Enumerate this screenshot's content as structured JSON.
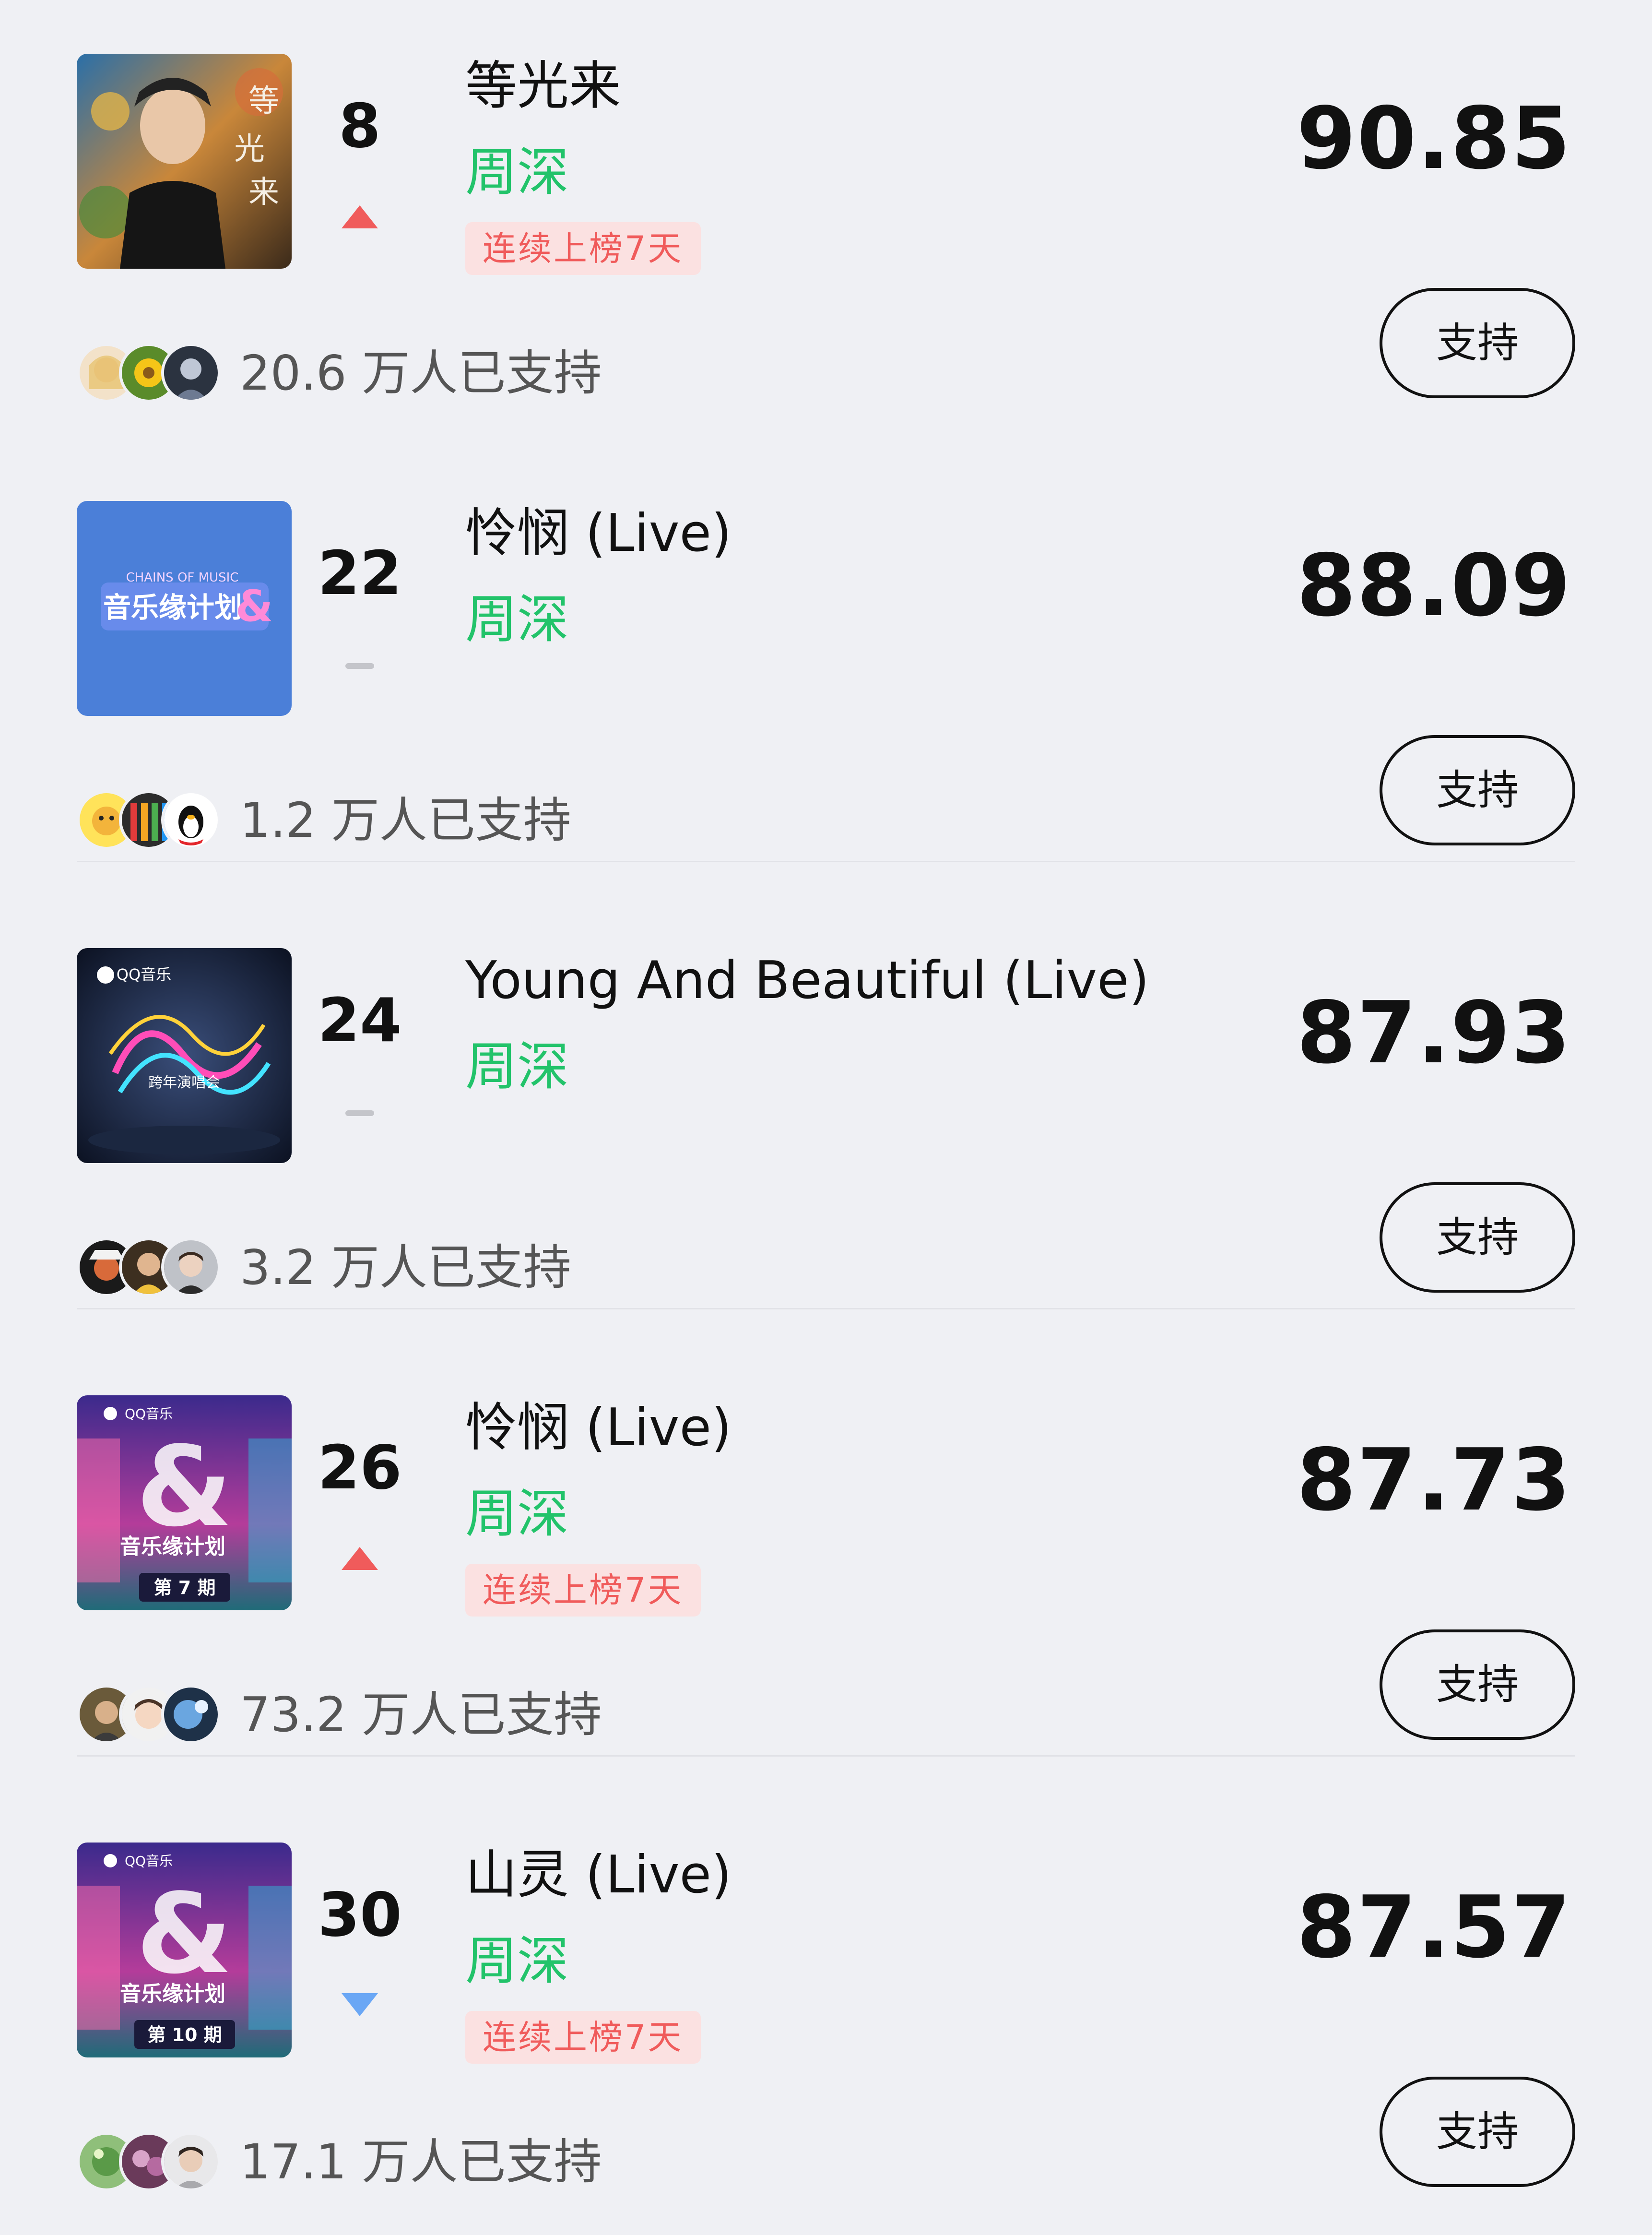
{
  "colors": {
    "background": "#eff0f4",
    "artist_green": "#22c36a",
    "trend_up": "#f05b5b",
    "trend_down": "#6aa7f5",
    "trend_same": "#c4c5ca",
    "badge_bg": "#fbe1e1",
    "badge_text": "#f05b5b"
  },
  "items": [
    {
      "rank": "8",
      "trend": "up",
      "title": "等光来",
      "artist": "周深",
      "badge": "连续上榜7天",
      "score": "90.85",
      "support_label": "支持",
      "supporters": "20.6 万人已支持",
      "cover_text": "等光来"
    },
    {
      "rank": "22",
      "trend": "same",
      "title": "怜悯 (Live)",
      "artist": "周深",
      "badge": "",
      "score": "88.09",
      "support_label": "支持",
      "supporters": "1.2 万人已支持",
      "cover_text": "音乐缘计划"
    },
    {
      "rank": "24",
      "trend": "same",
      "title": "Young And Beautiful (Live)",
      "artist": "周深",
      "badge": "",
      "score": "87.93",
      "support_label": "支持",
      "supporters": "3.2 万人已支持",
      "cover_text": "QQ音乐"
    },
    {
      "rank": "26",
      "trend": "up",
      "title": "怜悯 (Live)",
      "artist": "周深",
      "badge": "连续上榜7天",
      "score": "87.73",
      "support_label": "支持",
      "supporters": "73.2 万人已支持",
      "cover_text": "第 7 期"
    },
    {
      "rank": "30",
      "trend": "down",
      "title": "山灵 (Live)",
      "artist": "周深",
      "badge": "连续上榜7天",
      "score": "87.57",
      "support_label": "支持",
      "supporters": "17.1 万人已支持",
      "cover_text": "第 10 期"
    }
  ]
}
